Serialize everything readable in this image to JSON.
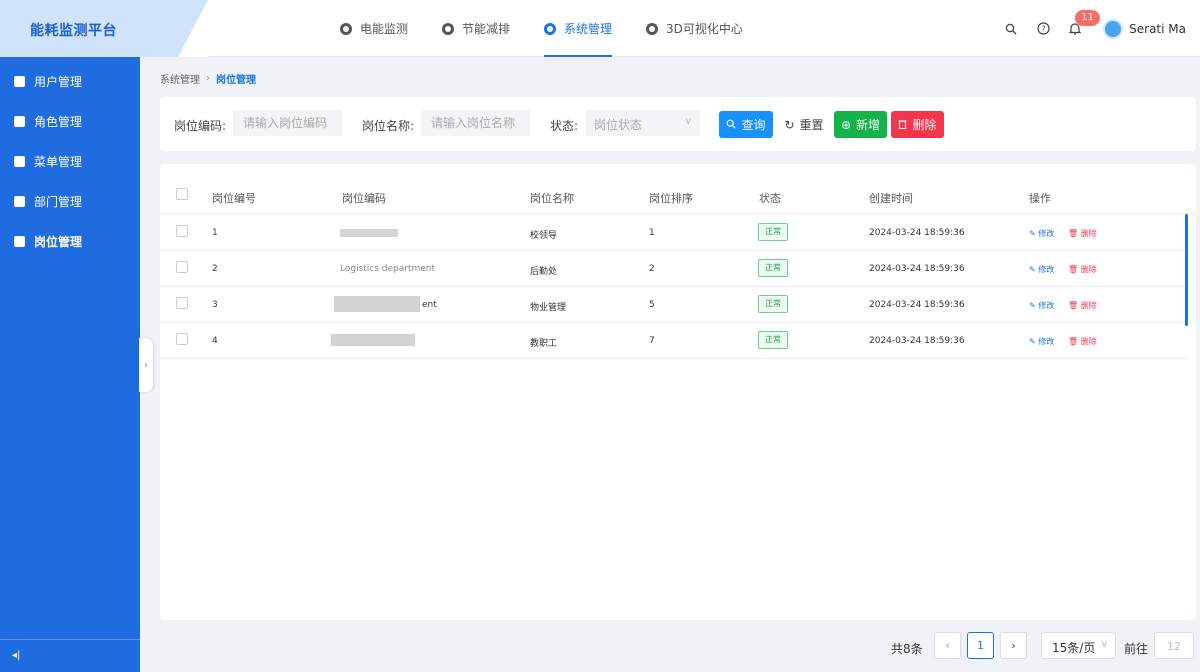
{
  "brand": {
    "title": "能耗监测平台"
  },
  "nav": {
    "tabs": [
      {
        "label": "电能监测",
        "icon": "energy-icon"
      },
      {
        "label": "节能减排",
        "icon": "leaf-icon"
      },
      {
        "label": "系统管理",
        "icon": "system-icon",
        "active": true
      },
      {
        "label": "3D可视化中心",
        "icon": "cube-icon"
      }
    ]
  },
  "header": {
    "notification_count": "11",
    "username": "Serati Ma"
  },
  "sidebar": {
    "items": [
      {
        "label": "用户管理"
      },
      {
        "label": "角色管理"
      },
      {
        "label": "菜单管理"
      },
      {
        "label": "部门管理"
      },
      {
        "label": "岗位管理",
        "active": true
      }
    ],
    "collapse_glyph": "◂|"
  },
  "breadcrumb": {
    "parent": "系统管理",
    "current": "岗位管理"
  },
  "search": {
    "code_label": "岗位编码:",
    "code_placeholder": "请输入岗位编码",
    "name_label": "岗位名称:",
    "name_placeholder": "请输入岗位名称",
    "status_label": "状态:",
    "status_placeholder": "岗位状态",
    "query_label": "查询",
    "reset_label": "重置",
    "add_label": "新增",
    "delete_label": "删除"
  },
  "table": {
    "columns": [
      "岗位编号",
      "岗位编码",
      "岗位名称",
      "岗位排序",
      "状态",
      "创建时间",
      "操作"
    ],
    "rows": [
      {
        "id": "1",
        "code": "",
        "name": "校领导",
        "sort": "1",
        "status": "正常",
        "created": "2024-03-24 18:59:36"
      },
      {
        "id": "2",
        "code": "Logistics department",
        "name": "后勤处",
        "sort": "2",
        "status": "正常",
        "created": "2024-03-24 18:59:36"
      },
      {
        "id": "3",
        "code": "ent",
        "name": "物业管理",
        "sort": "5",
        "status": "正常",
        "created": "2024-03-24 18:59:36"
      },
      {
        "id": "4",
        "code": "",
        "name": "教职工",
        "sort": "7",
        "status": "正常",
        "created": "2024-03-24 18:59:36"
      }
    ],
    "edit_label": "修改",
    "delete_label": "删除"
  },
  "pagination": {
    "total": "共8条",
    "current_page": "1",
    "page_size": "15条/页",
    "goto_label": "前往",
    "goto_value": "12"
  },
  "colors": {
    "primary": "#1a73e8",
    "sidebar": "#1f6be0",
    "success": "#13b34a",
    "danger": "#f5364a"
  }
}
